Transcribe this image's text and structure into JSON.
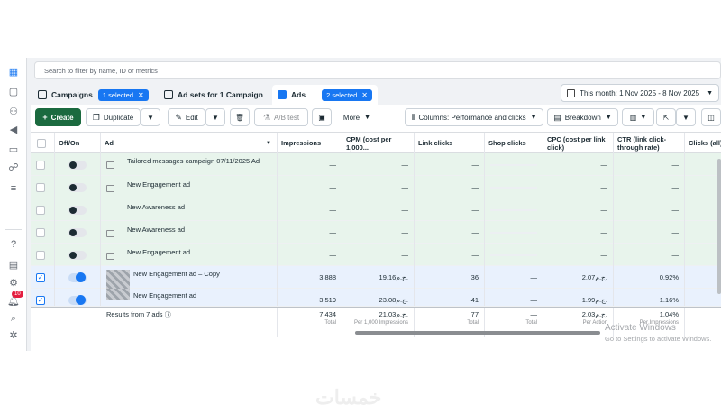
{
  "search": {
    "placeholder": "Search to filter by name, ID or metrics"
  },
  "tabs": {
    "campaigns": {
      "label": "Campaigns",
      "selected": "1 selected"
    },
    "adsets": {
      "label": "Ad sets for 1 Campaign"
    },
    "ads": {
      "label": "Ads",
      "selected": "2 selected"
    }
  },
  "daterange": "This month: 1 Nov 2025 - 8 Nov 2025",
  "toolbar": {
    "create": "Create",
    "duplicate": "Duplicate",
    "edit": "Edit",
    "abtest": "A/B test",
    "more": "More",
    "columns": "Columns: Performance and clicks",
    "breakdown": "Breakdown"
  },
  "columns": {
    "offon": "Off/On",
    "ad": "Ad",
    "impressions": "Impressions",
    "cpm": "CPM (cost per 1,000...",
    "linkclicks": "Link clicks",
    "shopclicks": "Shop clicks",
    "cpc": "CPC (cost per link click)",
    "ctr": "CTR (link click-through rate)",
    "clicks": "Clicks (all)"
  },
  "rows": [
    {
      "name": "Tailored messages campaign 07/11/2025 Ad",
      "impressions": "—",
      "cpm": "—",
      "linkclicks": "—",
      "shopclicks": "—",
      "cpc": "—",
      "ctr": "—"
    },
    {
      "name": "New Engagement ad",
      "impressions": "—",
      "cpm": "—",
      "linkclicks": "—",
      "shopclicks": "—",
      "cpc": "—",
      "ctr": "—"
    },
    {
      "name": "New Awareness ad",
      "impressions": "—",
      "cpm": "—",
      "linkclicks": "—",
      "shopclicks": "—",
      "cpc": "—",
      "ctr": "—"
    },
    {
      "name": "New Awareness ad",
      "impressions": "—",
      "cpm": "—",
      "linkclicks": "—",
      "shopclicks": "—",
      "cpc": "—",
      "ctr": "—"
    },
    {
      "name": "New Engagement ad",
      "impressions": "—",
      "cpm": "—",
      "linkclicks": "—",
      "shopclicks": "—",
      "cpc": "—",
      "ctr": "—"
    },
    {
      "name": "New Engagement ad – Copy",
      "impressions": "3,888",
      "cpm": "19.16ج.م.",
      "linkclicks": "36",
      "shopclicks": "—",
      "cpc": "2.07ج.م.",
      "ctr": "0.92%"
    },
    {
      "name": "New Engagement ad",
      "impressions": "3,519",
      "cpm": "23.08ج.م.",
      "linkclicks": "41",
      "shopclicks": "—",
      "cpc": "1.99ج.م.",
      "ctr": "1.16%"
    }
  ],
  "totals": {
    "label": "Results from 7 ads",
    "impressions": "7,434",
    "impressions_sub": "Total",
    "cpm": "21.03ج.م.",
    "cpm_sub": "Per 1,000 Impressions",
    "linkclicks": "77",
    "linkclicks_sub": "Total",
    "shopclicks": "—",
    "shopclicks_sub": "Total",
    "cpc": "2.03ج.م.",
    "cpc_sub": "Per Action",
    "ctr": "1.04%",
    "ctr_sub": "Per Impressions"
  },
  "rail_badge": "10",
  "watermark": {
    "line1": "Activate Windows",
    "line2": "Go to Settings to activate Windows."
  },
  "brand": "خمسات"
}
